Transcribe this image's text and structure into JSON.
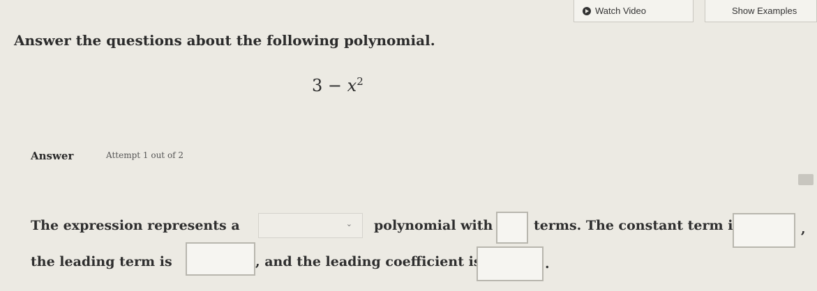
{
  "toolbar": {
    "watch_video_label": "Watch Video",
    "show_examples_label": "Show Examples"
  },
  "question": {
    "prompt": "Answer the questions about the following polynomial.",
    "expression_constant": "3",
    "expression_op": "−",
    "expression_var": "x",
    "expression_exp": "2"
  },
  "answer": {
    "label": "Answer",
    "attempt": "Attempt 1 out of 2"
  },
  "sentence": {
    "part1": "The expression represents a",
    "part2": "polynomial with",
    "part3": "terms. The constant term is",
    "part4": ",",
    "part5": "the leading term is",
    "part6": ", and the leading coefficient is",
    "part7": "."
  },
  "icons": {
    "play": "play-icon",
    "chevron": "chevron-down-icon",
    "corner": "keyboard-icon"
  }
}
